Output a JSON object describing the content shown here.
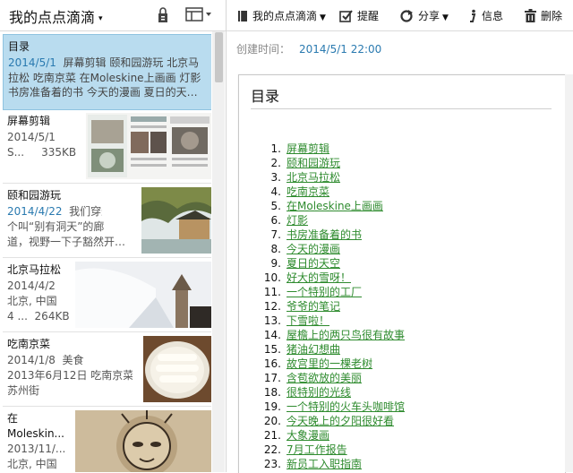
{
  "left_header": {
    "notebook_title": "我的点点滴滴",
    "caret": "▾"
  },
  "notes": [
    {
      "title": "目录",
      "date": "2014/5/1",
      "snippet": "屏幕剪辑 颐和园游玩 北京马拉松 吃南京菜 在Moleskine上画画 灯影 书房准备着的书 今天的漫画 夏日的天…",
      "selected": true
    },
    {
      "title": "屏幕剪辑",
      "date": "2014/5/1",
      "line3": "S...",
      "size": "335KB"
    },
    {
      "title": "颐和园游玩",
      "date": "2014/4/22",
      "snippet1": "我们穿过一",
      "snippet2": "个叫“别有洞天”的廊",
      "snippet3": "道，视野一下子豁然开…"
    },
    {
      "title": "北京马拉松",
      "date": "2014/4/2",
      "line3": "北京, 中国",
      "line4a": "4 ...",
      "size": "264KB"
    },
    {
      "title": "吃南京菜",
      "date": "2014/1/8",
      "tag": "美食",
      "line3": "2013年6月12日 吃南京菜",
      "line4": "苏州街"
    },
    {
      "title1": "在",
      "title2": "Moleskin...",
      "date": "2013/11/...",
      "line4": "北京, 中国"
    }
  ],
  "toolbar": {
    "notebook": "我的点点滴滴",
    "remind": "提醒",
    "share": "分享",
    "info": "信息",
    "delete": "删除"
  },
  "meta": {
    "created_label": "创建时间：",
    "created_value": "2014/5/1 22:00"
  },
  "document": {
    "title": "目录",
    "toc": [
      "屏幕剪辑",
      "颐和园游玩",
      "北京马拉松",
      "吃南京菜",
      "在Moleskine上画画",
      "灯影",
      "书房准备着的书",
      "今天的漫画",
      "夏日的天空",
      "好大的雪呀！",
      "一个特别的工厂",
      "爷爷的笔记",
      "下雪啦！",
      "屋檐上的两只鸟很有故事",
      "猪油幻想曲",
      "故宫里的一棵老树",
      "含苞欲放的美丽",
      "很特别的光线",
      "一个特别的火车头咖啡馆",
      "今天晚上的夕阳很好看",
      "大象漫画",
      "7月工作报告",
      "新员工入职指南"
    ]
  },
  "colors": {
    "selected_bg": "#b9dcef",
    "date_blue": "#2a7ab0",
    "link_green": "#2e8b2e"
  }
}
